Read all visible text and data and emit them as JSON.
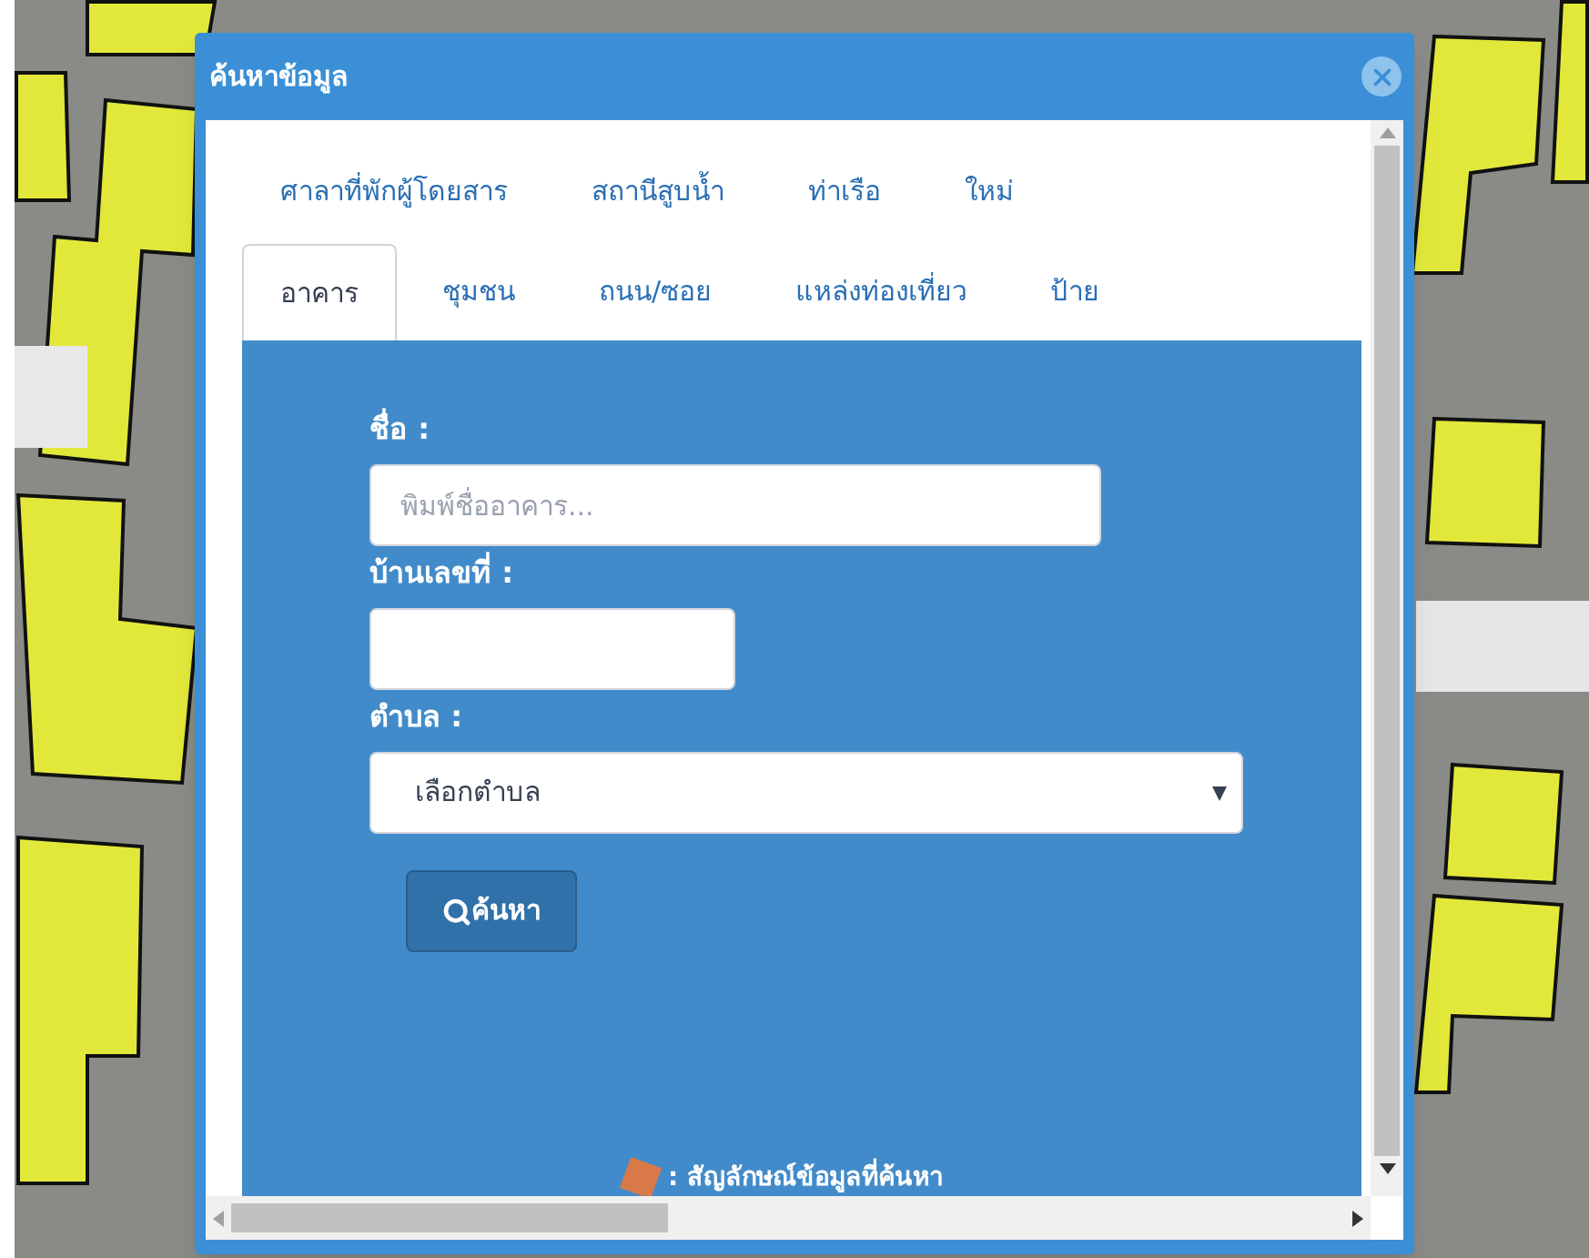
{
  "dialog": {
    "title": "ค้นหาข้อมูล"
  },
  "tab_rows": [
    {
      "tabs": [
        {
          "label": "ศาลาที่พักผู้โดยสาร",
          "selected": false
        },
        {
          "label": "สถานีสูบน้ำ",
          "selected": false
        },
        {
          "label": "ท่าเรือ",
          "selected": false
        },
        {
          "label": "ใหม่",
          "selected": false
        }
      ]
    },
    {
      "tabs": [
        {
          "label": "อาคาร",
          "selected": true
        },
        {
          "label": "ชุมชน",
          "selected": false
        },
        {
          "label": "ถนน/ซอย",
          "selected": false
        },
        {
          "label": "แหล่งท่องเที่ยว",
          "selected": false
        },
        {
          "label": "ป้าย",
          "selected": false
        }
      ]
    }
  ],
  "form": {
    "fields": [
      {
        "kind": "text",
        "label": "ชื่อ :",
        "placeholder": "พิมพ์ชื่ออาคาร..."
      },
      {
        "kind": "text",
        "label": "บ้านเลขที่ :"
      },
      {
        "kind": "select",
        "label": "ตำบล :",
        "value": "เลือกตำบล"
      }
    ],
    "search_button": "ค้นหา"
  },
  "legend": {
    "text": ": สัญลักษณ์ข้อมูลที่ค้นหา"
  }
}
